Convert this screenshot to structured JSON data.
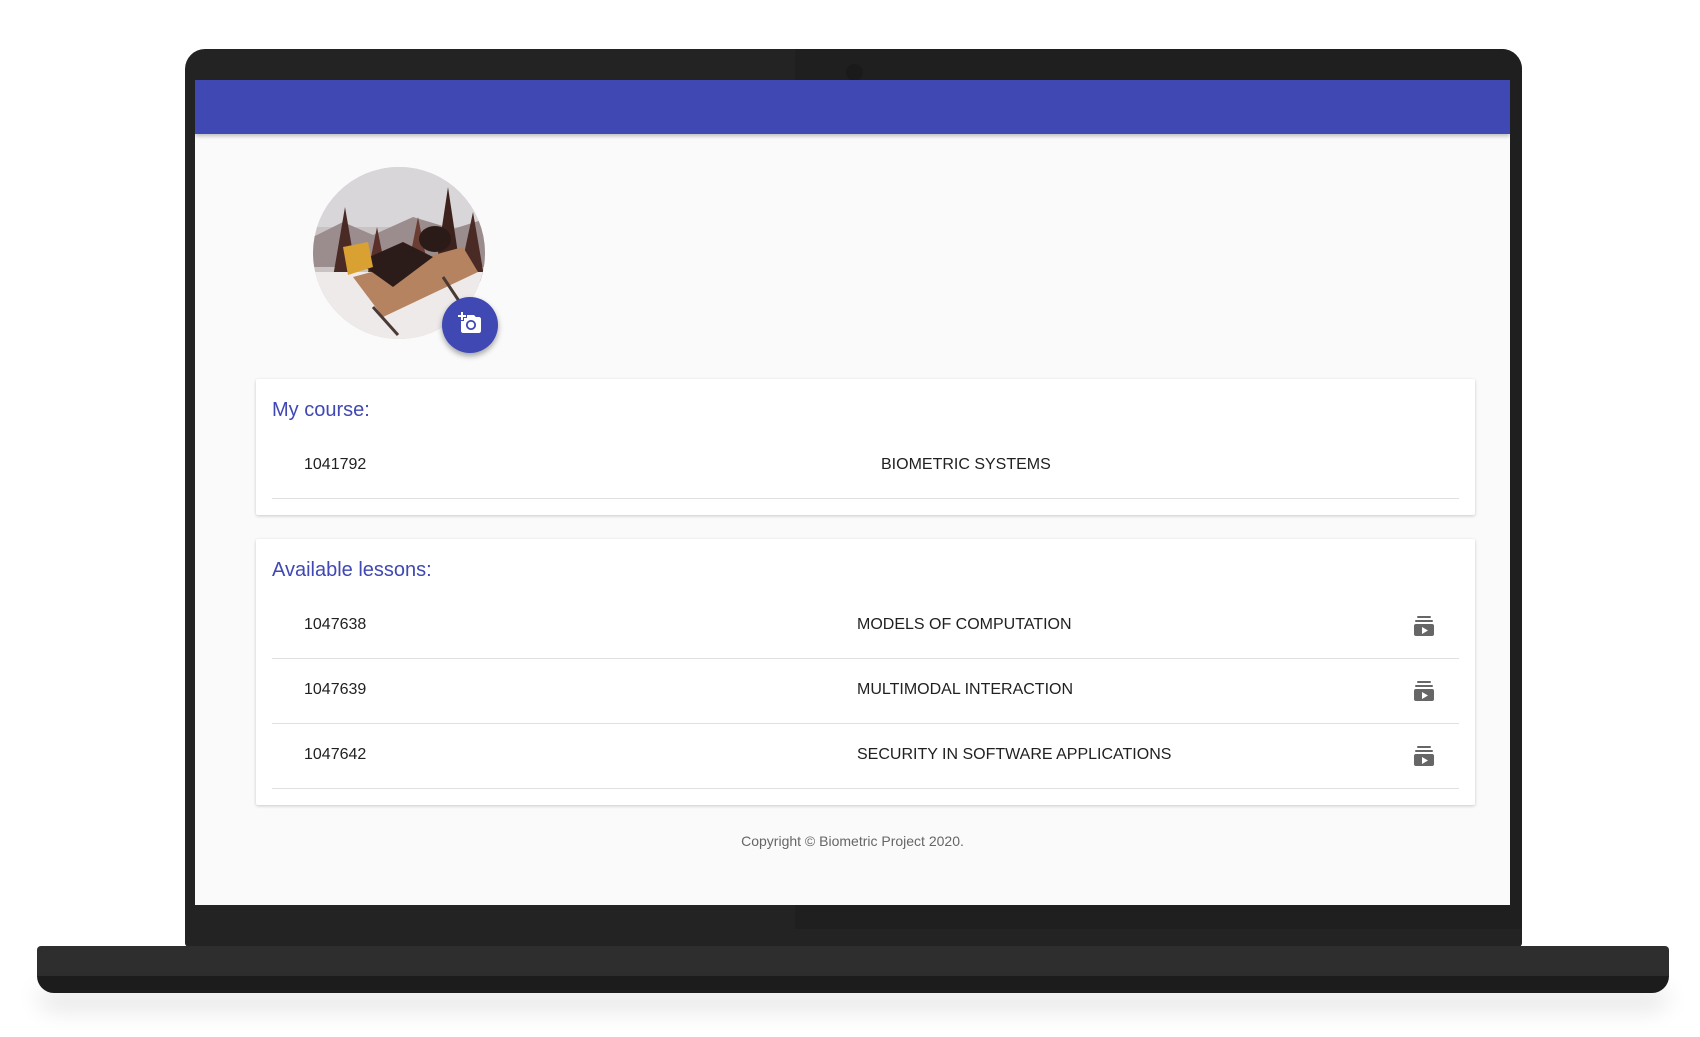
{
  "colors": {
    "primary": "#3f48b3",
    "background": "#fafafa",
    "card": "#ffffff",
    "text": "#212121",
    "muted": "#666666"
  },
  "profile": {
    "change_photo_icon": "add-a-photo-icon"
  },
  "my_course": {
    "title": "My course:",
    "code": "1041792",
    "name": "BIOMETRIC SYSTEMS"
  },
  "lessons": {
    "title": "Available lessons:",
    "action_icon": "video-library-icon",
    "items": [
      {
        "code": "1047638",
        "name": "MODELS OF COMPUTATION"
      },
      {
        "code": "1047639",
        "name": "MULTIMODAL INTERACTION"
      },
      {
        "code": "1047642",
        "name": "SECURITY IN SOFTWARE APPLICATIONS"
      }
    ]
  },
  "footer": {
    "copyright": "Copyright © Biometric Project 2020."
  }
}
